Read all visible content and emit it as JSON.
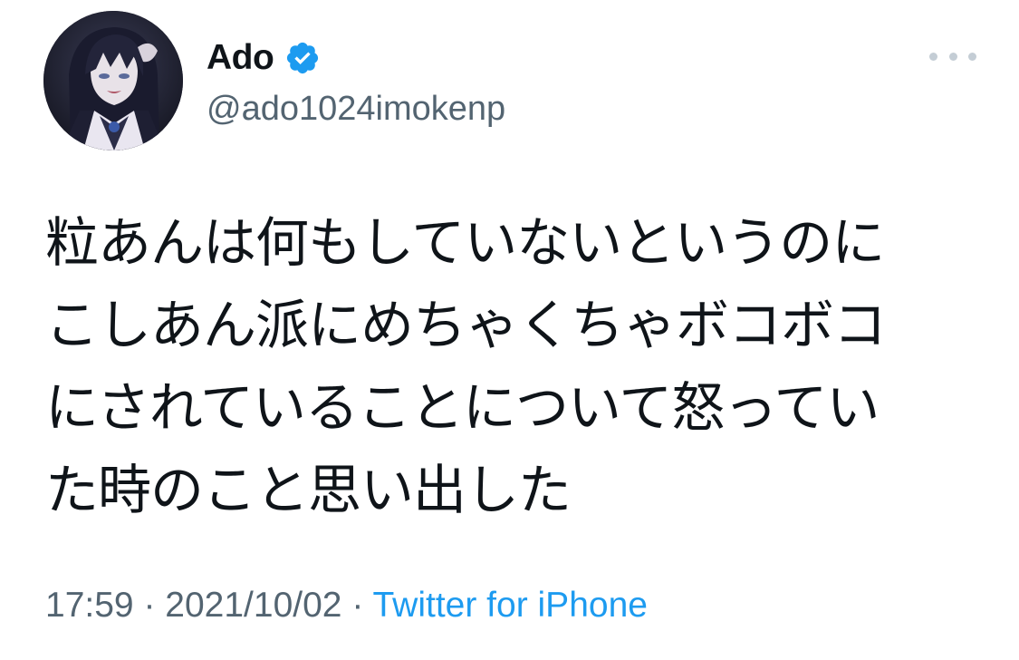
{
  "user": {
    "display_name": "Ado",
    "handle": "@ado1024imokenp",
    "verified": true,
    "avatar_icon": "avatar-illustration"
  },
  "more_icon": "more-horizontal-icon",
  "tweet": {
    "lines": [
      "粒あんは何もしていないというのに",
      "こしあん派にめちゃくちゃボコボコ",
      "にされていることについて怒ってい",
      "た時のこと思い出した"
    ]
  },
  "meta": {
    "time": "17:59",
    "separator": "·",
    "date": "2021/10/02",
    "source": "Twitter for iPhone"
  },
  "colors": {
    "text": "#0f1419",
    "secondary": "#536471",
    "link": "#1d9bf0",
    "verified": "#1d9bf0"
  }
}
